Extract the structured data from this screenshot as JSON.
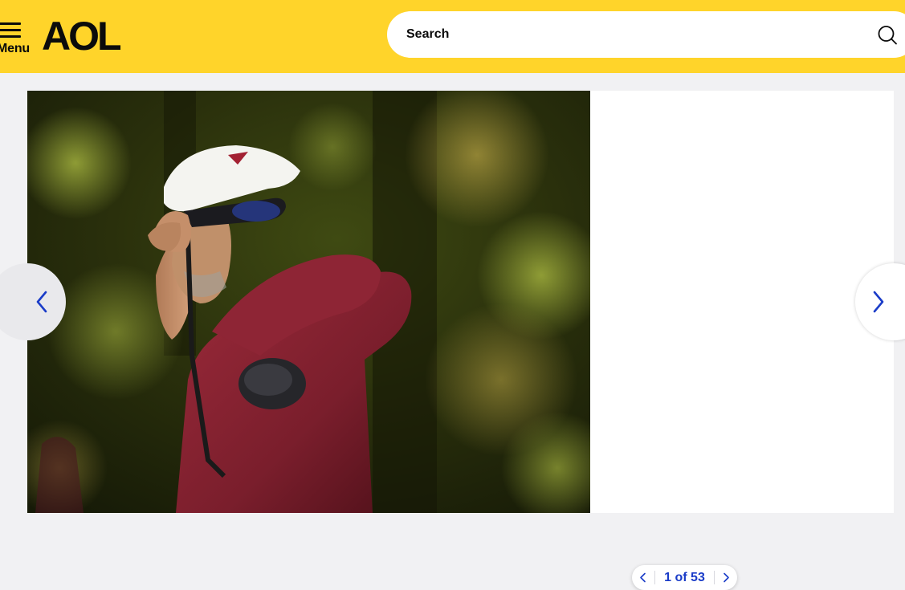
{
  "header": {
    "menu_label": "Menu",
    "logo_text": "AOL",
    "brand_color": "#ffd42a"
  },
  "search": {
    "placeholder": "Search",
    "icon": "search-icon"
  },
  "gallery": {
    "photo": {
      "subject": "golfer in maroon shirt and white cap following through a drive"
    },
    "prev_icon": "chevron-left-icon",
    "next_icon": "chevron-right-icon",
    "pager": {
      "label": "1 of 53",
      "current": 1,
      "total": 53
    },
    "accent_color": "#1a3cc8"
  }
}
